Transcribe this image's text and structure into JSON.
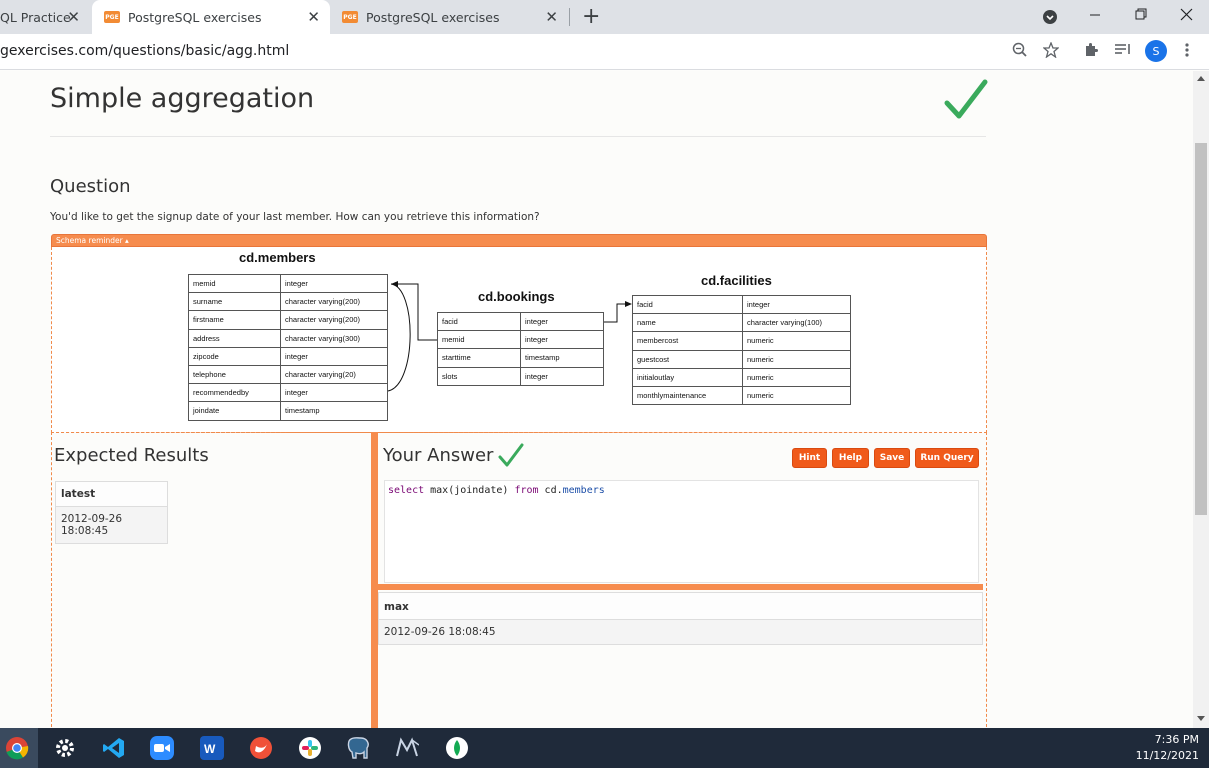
{
  "browser": {
    "tabs": [
      {
        "label": "QL Practice"
      },
      {
        "label": "PostgreSQL exercises",
        "favicon": "PGE"
      },
      {
        "label": "PostgreSQL exercises",
        "favicon": "PGE"
      }
    ],
    "close_glyph": "✕",
    "new_tab_glyph": "+",
    "url": "gexercises.com/questions/basic/agg.html",
    "profile_initial": "S"
  },
  "page": {
    "title": "Simple aggregation",
    "question_heading": "Question",
    "question_text": "You'd like to get the signup date of your last member. How can you retrieve this information?",
    "schema_reminder_label": "Schema reminder ▴",
    "schema": {
      "members": {
        "title": "cd.members",
        "rows": [
          [
            "memid",
            "integer"
          ],
          [
            "surname",
            "character varying(200)"
          ],
          [
            "firstname",
            "character varying(200)"
          ],
          [
            "address",
            "character varying(300)"
          ],
          [
            "zipcode",
            "integer"
          ],
          [
            "telephone",
            "character varying(20)"
          ],
          [
            "recommendedby",
            "integer"
          ],
          [
            "joindate",
            "timestamp"
          ]
        ]
      },
      "bookings": {
        "title": "cd.bookings",
        "rows": [
          [
            "facid",
            "integer"
          ],
          [
            "memid",
            "integer"
          ],
          [
            "starttime",
            "timestamp"
          ],
          [
            "slots",
            "integer"
          ]
        ]
      },
      "facilities": {
        "title": "cd.facilities",
        "rows": [
          [
            "facid",
            "integer"
          ],
          [
            "name",
            "character varying(100)"
          ],
          [
            "membercost",
            "numeric"
          ],
          [
            "guestcost",
            "numeric"
          ],
          [
            "initialoutlay",
            "numeric"
          ],
          [
            "monthlymaintenance",
            "numeric"
          ]
        ]
      }
    },
    "expected_results_heading": "Expected Results",
    "expected": {
      "column": "latest",
      "value": "2012-09-26 18:08:45"
    },
    "your_answer_heading": "Your Answer",
    "buttons": {
      "hint": "Hint",
      "help": "Help",
      "save": "Save",
      "run": "Run Query"
    },
    "query": {
      "kw1": "select",
      "mid": " max(joindate) ",
      "kw2": "from",
      "schema": " cd.",
      "table": "members"
    },
    "result": {
      "column": "max",
      "value": "2012-09-26 18:08:45"
    }
  },
  "taskbar": {
    "time": "7:36 PM",
    "date": "11/12/2021"
  }
}
